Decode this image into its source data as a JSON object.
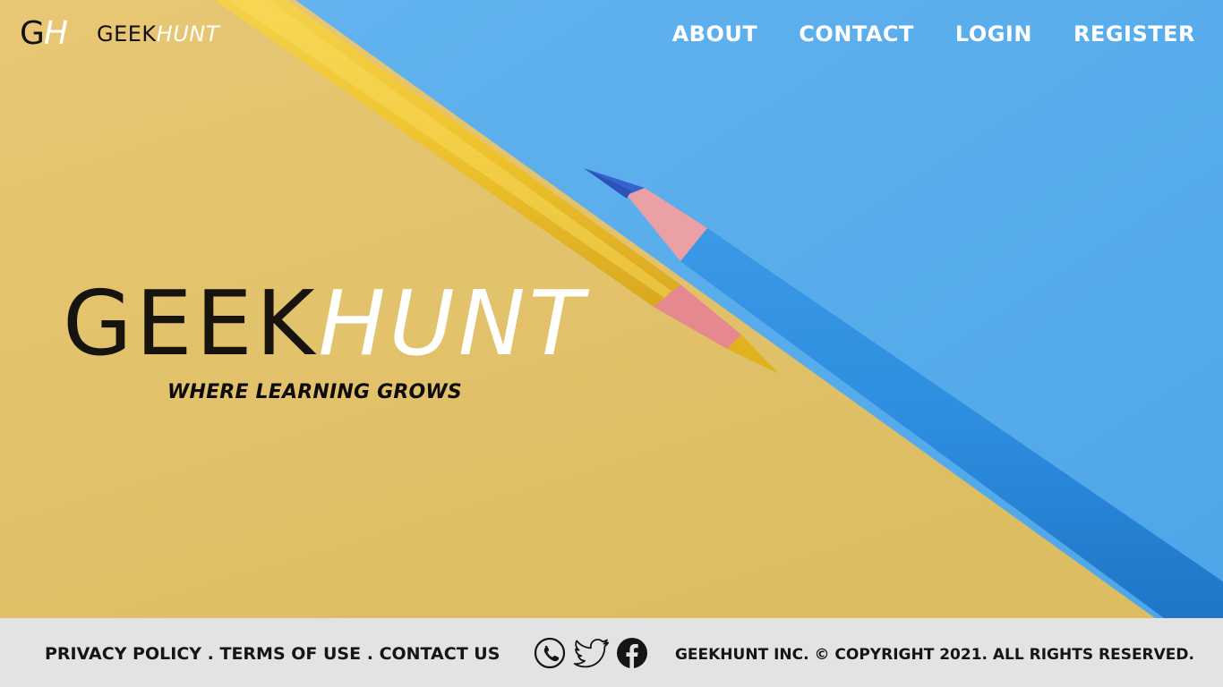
{
  "brand": {
    "mark_g": "G",
    "mark_h": "H",
    "name_part1": "GEEK",
    "name_part2": "HUNT"
  },
  "nav": {
    "items": [
      {
        "label": "ABOUT"
      },
      {
        "label": "CONTACT"
      },
      {
        "label": "LOGIN"
      },
      {
        "label": "REGISTER"
      }
    ]
  },
  "hero": {
    "title_part1": "GEEK",
    "title_part2": "HUNT",
    "tagline": "WHERE LEARNING GROWS"
  },
  "footer": {
    "links": [
      {
        "label": "PRIVACY POLICY"
      },
      {
        "label": "TERMS OF USE"
      },
      {
        "label": "CONTACT US"
      }
    ],
    "separator": " . ",
    "social_icons": [
      "phone-icon",
      "twitter-icon",
      "facebook-icon"
    ],
    "copyright": "GEEKHUNT INC. © COPYRIGHT 2021. ALL RIGHTS RESERVED."
  },
  "colors": {
    "paper_yellow": "#e3c06a",
    "paper_blue": "#58aceb",
    "pencil_yellow": "#f0c632",
    "pencil_blue": "#2f8fe0",
    "footer_bg": "#e3e3e3",
    "text_dark": "#151515",
    "text_light": "#ffffff"
  }
}
